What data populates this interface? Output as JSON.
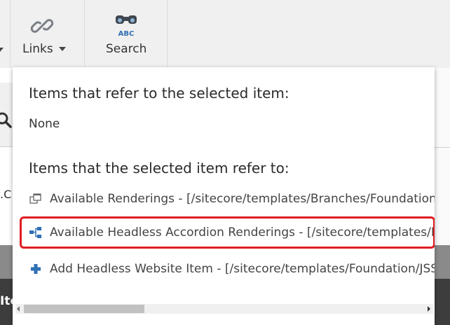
{
  "ribbon": {
    "links_label": "Links",
    "search_label": "Search",
    "search_icon_text": "ABC"
  },
  "background": {
    "fragment_text": ".C",
    "dark_band_text": "Ite"
  },
  "flyout": {
    "referrers_heading": "Items that refer to the selected item:",
    "referrers_none": "None",
    "references_heading": "Items that the selected item refer to:",
    "references": [
      {
        "label": "Available Renderings - [/sitecore/templates/Branches/Foundation/JSS Experience Accelerator/Presentation/Available Renderings]",
        "icon": "rendering-folder-icon"
      },
      {
        "label": "Available Headless Accordion Renderings - [/sitecore/templates/Branches/Foundation/JSS Experience Accelerator/Presentation/Available Renderings]",
        "icon": "hierarchy-icon"
      },
      {
        "label": "Add Headless Website Item - [/sitecore/templates/Foundation/JSS Experience Accelerator/Multisite/Add Headless Website Item]",
        "icon": "plus-icon"
      }
    ],
    "highlighted_index": 1
  },
  "colors": {
    "highlight_border": "#e01d24",
    "ribbon_bg": "#f0f0f0",
    "icon_blue": "#2f6fb4"
  }
}
